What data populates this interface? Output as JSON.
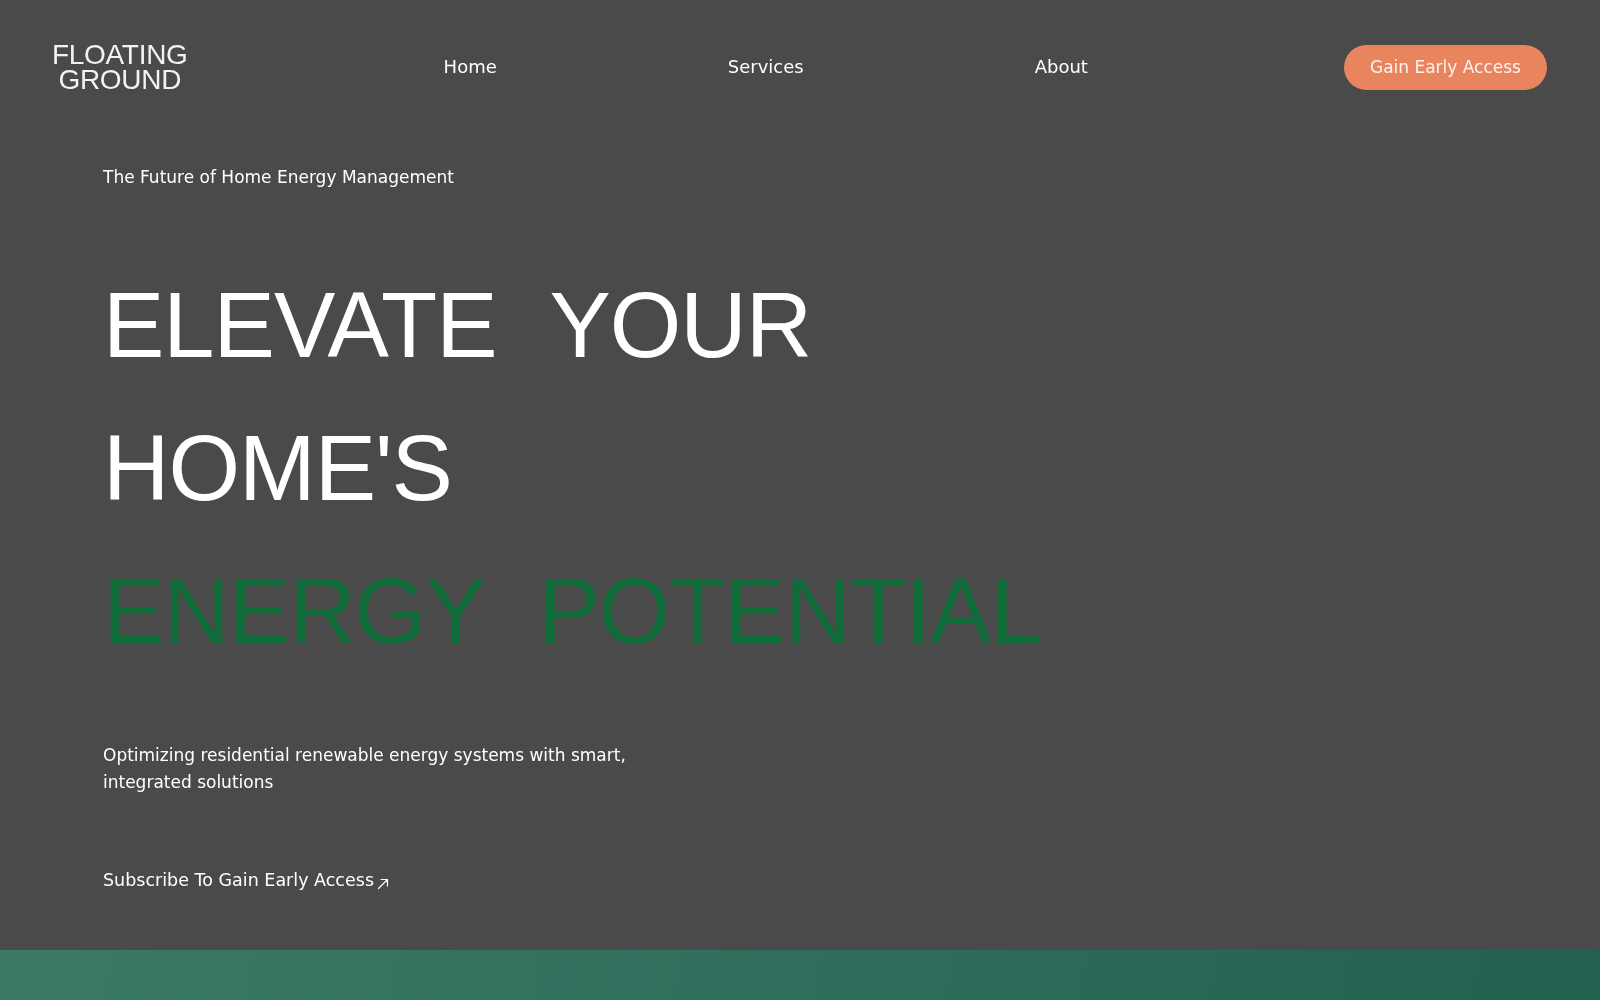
{
  "header": {
    "logo": {
      "lines": [
        "FLOATING",
        "GROUND"
      ]
    },
    "nav": [
      {
        "label": "Home"
      },
      {
        "label": "Services"
      },
      {
        "label": "About"
      }
    ],
    "cta_button": {
      "label": "Gain Early Access"
    }
  },
  "hero": {
    "eyebrow": "The Future of Home Energy Management",
    "headline": [
      {
        "text": "ELEVATE YOUR",
        "color": "#ffffff"
      },
      {
        "text": "HOME'S",
        "color": "#ffffff"
      },
      {
        "text": "ENERGY POTENTIAL",
        "color": "#0f6b38"
      }
    ],
    "description": "Optimizing residential renewable energy systems with smart, integrated solutions",
    "subscribe_link": {
      "label": "Subscribe To Gain Early Access"
    }
  }
}
